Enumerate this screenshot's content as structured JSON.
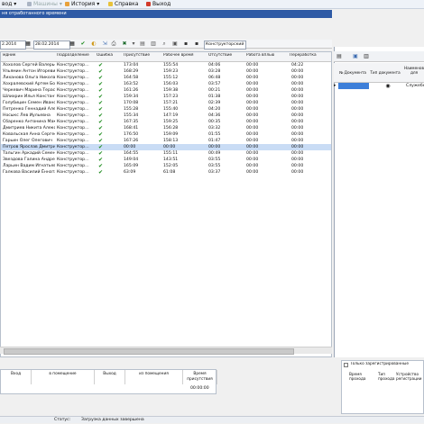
{
  "menu": {
    "items": [
      {
        "label": "вод",
        "icon": "dropdown-icon"
      },
      {
        "label": "Машины",
        "icon": "car-icon"
      },
      {
        "label": "История",
        "icon": "history-icon"
      },
      {
        "label": "Справка",
        "icon": "help-icon"
      },
      {
        "label": "Выход",
        "icon": "exit-icon"
      }
    ]
  },
  "title": "ня отработанного времени",
  "toolbar": {
    "date_from": "2.2014",
    "date_to": "28.02.2014",
    "filter_value": "Конструкторский"
  },
  "grid": {
    "columns": [
      "мдник",
      "Подразделение",
      "Ошибка",
      "Присутствие",
      "Рабочее время",
      "Отсутствие",
      "Работа вплью",
      "Переработка"
    ],
    "rows": [
      {
        "name": "Хохолов Сергей Валерьев",
        "dept": "Конструктор…",
        "present": "173:04",
        "work": "155:54",
        "absent": "04:06",
        "plan": "00:00",
        "over": "04:22"
      },
      {
        "name": "Ульямин Антон Игоревич",
        "dept": "Конструктор…",
        "present": "168:29",
        "work": "159:23",
        "absent": "03:28",
        "plan": "00:00",
        "over": "00:00"
      },
      {
        "name": "Лиханова Ольга Николаевна",
        "dept": "Конструктор…",
        "present": "164:58",
        "work": "155:12",
        "absent": "06:48",
        "plan": "00:00",
        "over": "00:00"
      },
      {
        "name": "Хохралевский Артем Бор",
        "dept": "Конструктор…",
        "present": "163:52",
        "work": "156:03",
        "absent": "03:57",
        "plan": "00:00",
        "over": "00:00"
      },
      {
        "name": "Черкевич Марина Терас",
        "dept": "Конструктор…",
        "present": "161:26",
        "work": "159:38",
        "absent": "00:21",
        "plan": "00:00",
        "over": "00:00"
      },
      {
        "name": "Шлихрин Илья Констант",
        "dept": "Конструктор…",
        "present": "159:34",
        "work": "157:23",
        "absent": "01:38",
        "plan": "00:00",
        "over": "00:00"
      },
      {
        "name": "Голубицин Семен Иванов",
        "dept": "Конструктор…",
        "present": "170:08",
        "work": "157:21",
        "absent": "02:39",
        "plan": "00:00",
        "over": "00:00"
      },
      {
        "name": "Петренко Геннадий Алек",
        "dept": "Конструктор…",
        "present": "155:28",
        "work": "155:40",
        "absent": "04:20",
        "plan": "00:00",
        "over": "00:00"
      },
      {
        "name": "Носыкс Лев Иульевна",
        "dept": "Конструктор…",
        "present": "155:34",
        "work": "147:19",
        "absent": "04:36",
        "plan": "00:00",
        "over": "00:00"
      },
      {
        "name": "Сбаренко Антонина Мака",
        "dept": "Конструктор…",
        "present": "167:35",
        "work": "159:25",
        "absent": "00:35",
        "plan": "00:00",
        "over": "00:00"
      },
      {
        "name": "Дмитриев Никита Алекс",
        "dept": "Конструктор…",
        "present": "168:41",
        "work": "156:28",
        "absent": "03:32",
        "plan": "00:00",
        "over": "00:00"
      },
      {
        "name": "Ковальская Анна Сергеев",
        "dept": "Конструктор…",
        "present": "176:50",
        "work": "159:09",
        "absent": "01:55",
        "plan": "00:00",
        "over": "00:00"
      },
      {
        "name": "Гарьин Олег Олегович",
        "dept": "Конструктор…",
        "present": "167:26",
        "work": "158:13",
        "absent": "01:47",
        "plan": "00:00",
        "over": "00:00"
      },
      {
        "name": "Петров Ярослав Дмитри",
        "dept": "Конструктор…",
        "present": "00:00",
        "work": "00:00",
        "absent": "00:00",
        "plan": "00:00",
        "over": "00:00"
      },
      {
        "name": "Тальгин Аркадий Семен",
        "dept": "Конструктор…",
        "present": "164:55",
        "work": "155:11",
        "absent": "00:49",
        "plan": "00:00",
        "over": "00:00"
      },
      {
        "name": "Звездова Галина Андре",
        "dept": "Конструктор…",
        "present": "149:04",
        "work": "143:51",
        "absent": "03:55",
        "plan": "00:00",
        "over": "00:00"
      },
      {
        "name": "Ларьин Вадим Игнатьев",
        "dept": "Конструктор…",
        "present": "165:09",
        "work": "152:05",
        "absent": "03:55",
        "plan": "00:00",
        "over": "00:00"
      },
      {
        "name": "Галкова Василий Ённата",
        "dept": "Конструктор…",
        "present": "63:09",
        "work": "61:08",
        "absent": "03:37",
        "plan": "00:00",
        "over": "00:00"
      }
    ],
    "selected_index": 13
  },
  "right_panel": {
    "columns": [
      "№ Документа",
      "Тип документа",
      "Наименование для"
    ],
    "row": {
      "doc_number": "",
      "doc_type_icon": "record-icon",
      "name": "Служебн"
    }
  },
  "bottom": {
    "columns": [
      "Вход",
      "в помещение",
      "Выход",
      "из помещения",
      "Время присутствия"
    ],
    "value": "00:00:00"
  },
  "bottom_right": {
    "checkbox_label": "Только зарегистрированные",
    "columns": [
      "Время прохода",
      "Тип прохода",
      "Устройство регистрации"
    ]
  },
  "status": {
    "label": "Статус:",
    "text": "Загрузка данных завершена"
  }
}
